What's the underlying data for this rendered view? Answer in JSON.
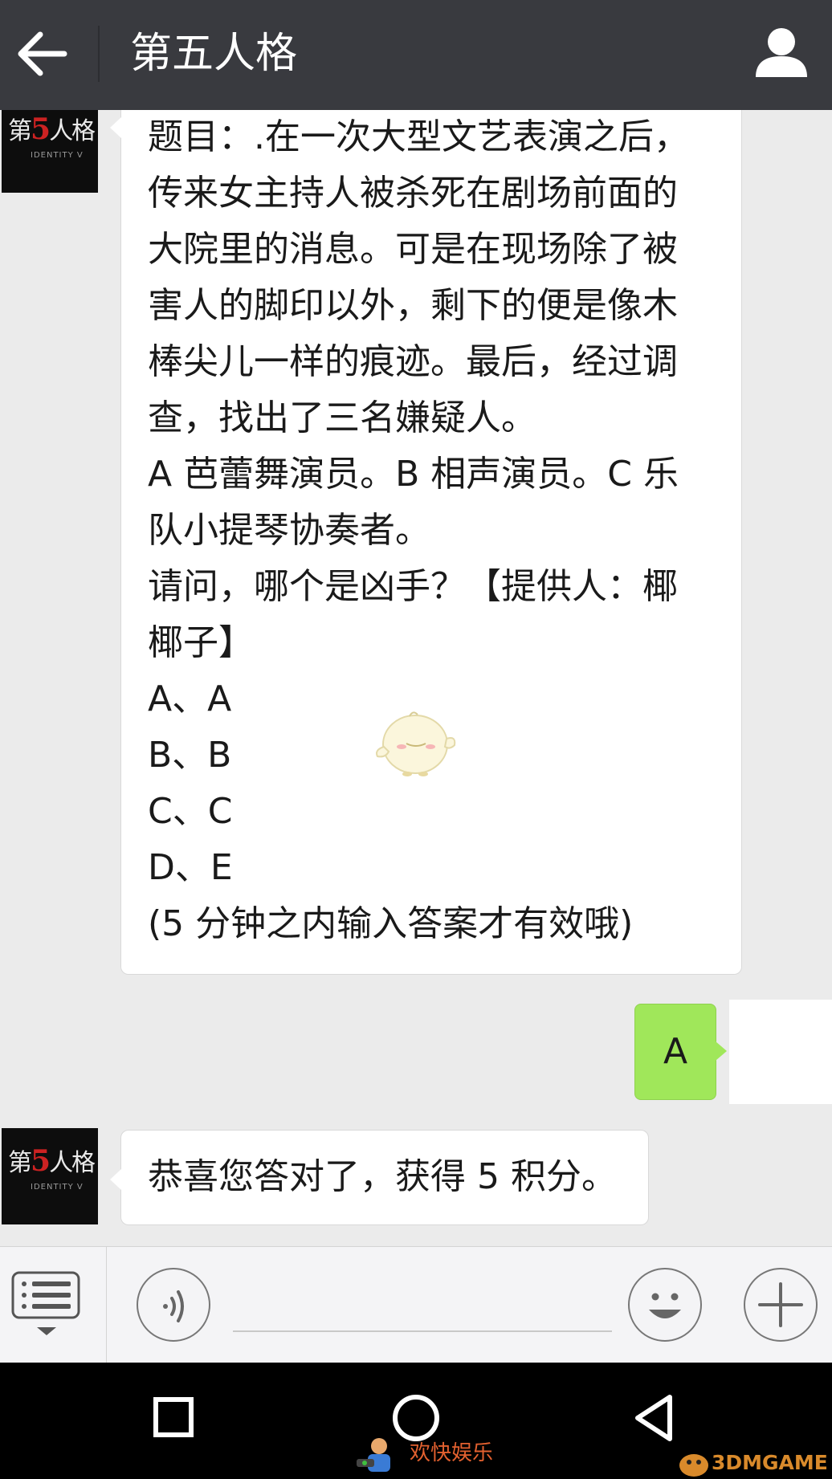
{
  "header": {
    "title": "第五人格"
  },
  "avatar": {
    "logo_main_pre": "第",
    "logo_main_five": "5",
    "logo_main_post": "人格",
    "logo_sub": "IDENTITY V"
  },
  "question": {
    "lines": [
      "题目：.在一次大型文艺表演之后，",
      "传来女主持人被杀死在剧场前面的",
      "大院里的消息。可是在现场除了被",
      "害人的脚印以外，剩下的便是像木",
      "棒尖儿一样的痕迹。最后，经过调",
      "查，找出了三名嫌疑人。",
      "A 芭蕾舞演员。B 相声演员。C 乐",
      "队小提琴协奏者。",
      "请问，哪个是凶手？【提供人：椰",
      "椰子】",
      "A、A",
      "B、B",
      "C、C",
      "D、E",
      "(5 分钟之内输入答案才有效哦)"
    ]
  },
  "my_reply": "A",
  "bot_reply": "恭喜您答对了，获得 5 积分。",
  "input": {
    "value": ""
  },
  "watermarks": {
    "center": "欢快娱乐",
    "right": "3DMGAME"
  },
  "colors": {
    "header_bg": "#393a3f",
    "chat_bg": "#ebebeb",
    "outgoing_bubble": "#a0e75a",
    "incoming_bubble": "#ffffff",
    "nav_bg": "#000000"
  }
}
